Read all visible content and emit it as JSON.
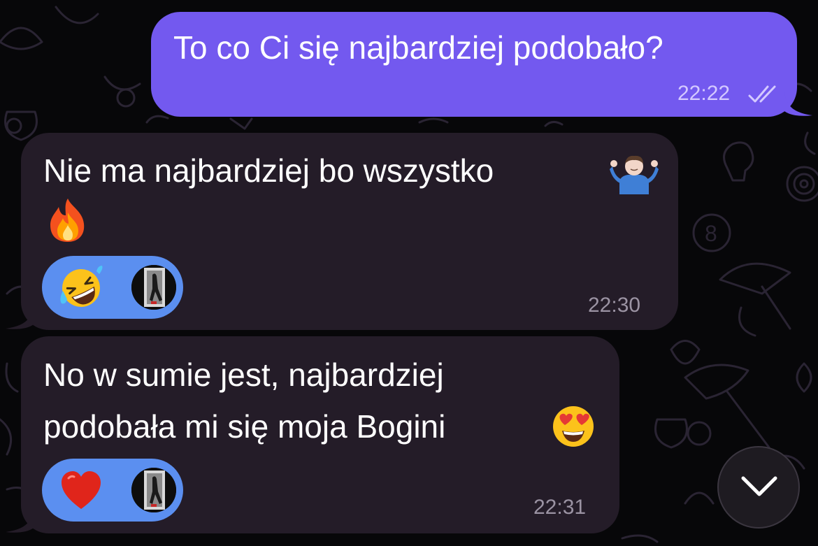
{
  "messages": [
    {
      "direction": "outgoing",
      "text": "To co Ci się najbardziej podobało?",
      "time": "22:22",
      "status_icon": "double-check-icon"
    },
    {
      "direction": "incoming",
      "text_line1": "Nie ma najbardziej bo wszystko",
      "emoji_inline": "person-shrugging",
      "emoji_line2": "fire",
      "reaction_emoji": "rolling-on-floor-laughing",
      "time": "22:30"
    },
    {
      "direction": "incoming",
      "text_line1": "No w sumie jest, najbardziej",
      "text_line2": "podobała mi się moja Bogini",
      "emoji_inline": "smiling-face-with-heart-eyes",
      "reaction_emoji": "red-heart",
      "time": "22:31"
    }
  ],
  "scroll_button": {
    "icon": "chevron-down-icon"
  },
  "colors": {
    "background": "#070709",
    "outgoing_bubble": "#7359ef",
    "incoming_bubble": "#241c28",
    "reaction_pill": "#5b8ff0"
  }
}
